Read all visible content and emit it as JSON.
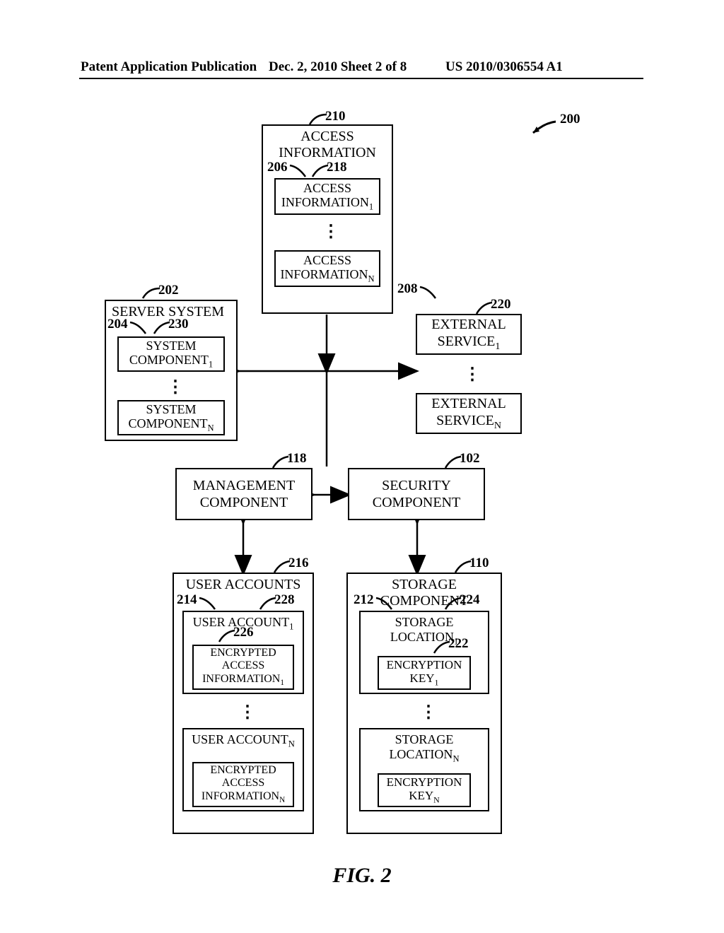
{
  "header": {
    "left": "Patent Application Publication",
    "center": "Dec. 2, 2010  Sheet 2 of 8",
    "right": "US 2010/0306554 A1"
  },
  "figure_label": "FIG. 2",
  "refs": {
    "r200": "200",
    "r210": "210",
    "r206": "206",
    "r218": "218",
    "r202": "202",
    "r204": "204",
    "r230": "230",
    "r208": "208",
    "r220": "220",
    "r118": "118",
    "r102": "102",
    "r216": "216",
    "r110": "110",
    "r214": "214",
    "r228": "228",
    "r226": "226",
    "r212": "212",
    "r224": "224",
    "r222": "222"
  },
  "blocks": {
    "access_info": {
      "title_l1": "ACCESS",
      "title_l2": "INFORMATION",
      "item1_l1": "ACCESS",
      "item1_l2": "INFORMATION",
      "item1_sub": "1",
      "itemN_l1": "ACCESS",
      "itemN_l2": "INFORMATION",
      "itemN_sub": "N"
    },
    "server": {
      "title": "SERVER SYSTEM",
      "item1_l1": "SYSTEM",
      "item1_l2": "COMPONENT",
      "item1_sub": "1",
      "itemN_l1": "SYSTEM",
      "itemN_l2": "COMPONENT",
      "itemN_sub": "N"
    },
    "external": {
      "item1_l1": "EXTERNAL",
      "item1_l2": "SERVICE",
      "item1_sub": "1",
      "itemN_l1": "EXTERNAL",
      "itemN_l2": "SERVICE",
      "itemN_sub": "N"
    },
    "management": {
      "l1": "MANAGEMENT",
      "l2": "COMPONENT"
    },
    "security": {
      "l1": "SECURITY",
      "l2": "COMPONENT"
    },
    "user_accounts": {
      "title": "USER ACCOUNTS",
      "u1": "USER ACCOUNT",
      "u1_sub": "1",
      "uN": "USER ACCOUNT",
      "uN_sub": "N",
      "e1_l1": "ENCRYPTED",
      "e1_l2": "ACCESS",
      "e1_l3": "INFORMATION",
      "e1_sub": "1",
      "eN_l1": "ENCRYPTED",
      "eN_l2": "ACCESS",
      "eN_l3": "INFORMATION",
      "eN_sub": "N"
    },
    "storage": {
      "title": "STORAGE COMPONENT",
      "s1_l1": "STORAGE",
      "s1_l2": "LOCATION",
      "s1_sub": "1",
      "sN_l1": "STORAGE",
      "sN_l2": "LOCATION",
      "sN_sub": "N",
      "k1_l1": "ENCRYPTION",
      "k1_l2": "KEY",
      "k1_sub": "1",
      "kN_l1": "ENCRYPTION",
      "kN_l2": "KEY",
      "kN_sub": "N"
    }
  }
}
